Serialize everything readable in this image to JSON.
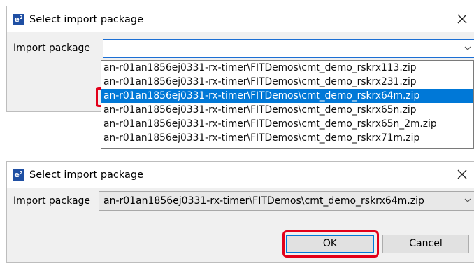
{
  "dialog1": {
    "title": "Select import package",
    "app_icon_letter": "e",
    "app_icon_superscript": "2",
    "field_label": "Import package",
    "combo_value": "",
    "options": [
      "an-r01an1856ej0331-rx-timer\\FITDemos\\cmt_demo_rskrx113.zip",
      "an-r01an1856ej0331-rx-timer\\FITDemos\\cmt_demo_rskrx231.zip",
      "an-r01an1856ej0331-rx-timer\\FITDemos\\cmt_demo_rskrx64m.zip",
      "an-r01an1856ej0331-rx-timer\\FITDemos\\cmt_demo_rskrx65n.zip",
      "an-r01an1856ej0331-rx-timer\\FITDemos\\cmt_demo_rskrx65n_2m.zip",
      "an-r01an1856ej0331-rx-timer\\FITDemos\\cmt_demo_rskrx71m.zip"
    ]
  },
  "dialog2": {
    "title": "Select import package",
    "app_icon_letter": "e",
    "app_icon_superscript": "2",
    "field_label": "Import package",
    "combo_value": "an-r01an1856ej0331-rx-timer\\FITDemos\\cmt_demo_rskrx64m.zip",
    "ok_label": "OK",
    "cancel_label": "Cancel"
  },
  "colors": {
    "highlight": "#e2001a",
    "selection": "#0078d7",
    "accent_border": "#1c6fd4"
  }
}
